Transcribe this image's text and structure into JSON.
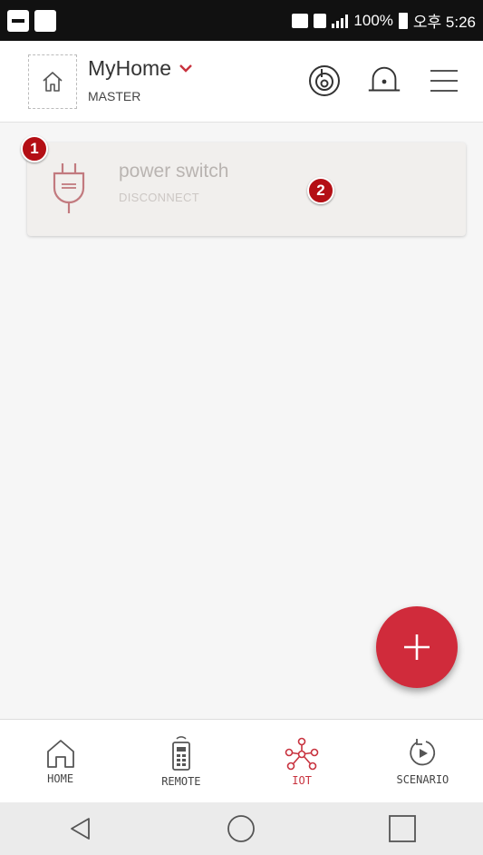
{
  "status_bar": {
    "battery": "100%",
    "time": "오후 5:26"
  },
  "header": {
    "home_name": "MyHome",
    "role": "MASTER"
  },
  "devices": [
    {
      "name": "power switch",
      "status": "DISCONNECT"
    }
  ],
  "badges": [
    "1",
    "2"
  ],
  "fab": {
    "label": "+"
  },
  "bottom_nav": [
    {
      "label": "HOME"
    },
    {
      "label": "REMOTE"
    },
    {
      "label": "IOT"
    },
    {
      "label": "SCENARIO"
    }
  ],
  "colors": {
    "accent": "#c8323e",
    "badge": "#b40f15"
  }
}
